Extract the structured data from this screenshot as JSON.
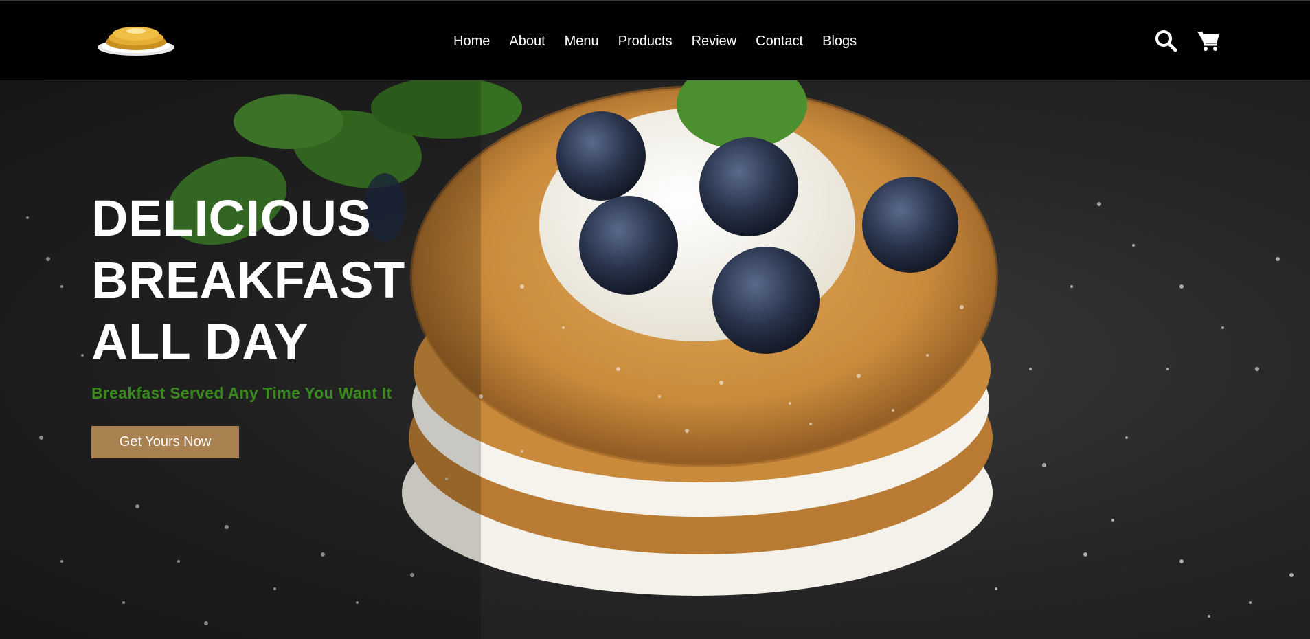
{
  "header": {
    "logo_name": "pancake-logo-icon",
    "nav": [
      "Home",
      "About",
      "Menu",
      "Products",
      "Review",
      "Contact",
      "Blogs"
    ],
    "icons": [
      "search-icon",
      "cart-icon"
    ]
  },
  "hero": {
    "title_lines": [
      "DELICIOUS",
      "BREAKFAST",
      "ALL DAY"
    ],
    "subtitle": "Breakfast Served Any Time You Want It",
    "cta_label": "Get Yours Now",
    "image_name": "pancake-stack-with-blueberries-image"
  },
  "colors": {
    "header_bg": "#000000",
    "subtitle": "#3a8a1e",
    "cta_bg": "#a9804f",
    "text": "#ffffff"
  }
}
